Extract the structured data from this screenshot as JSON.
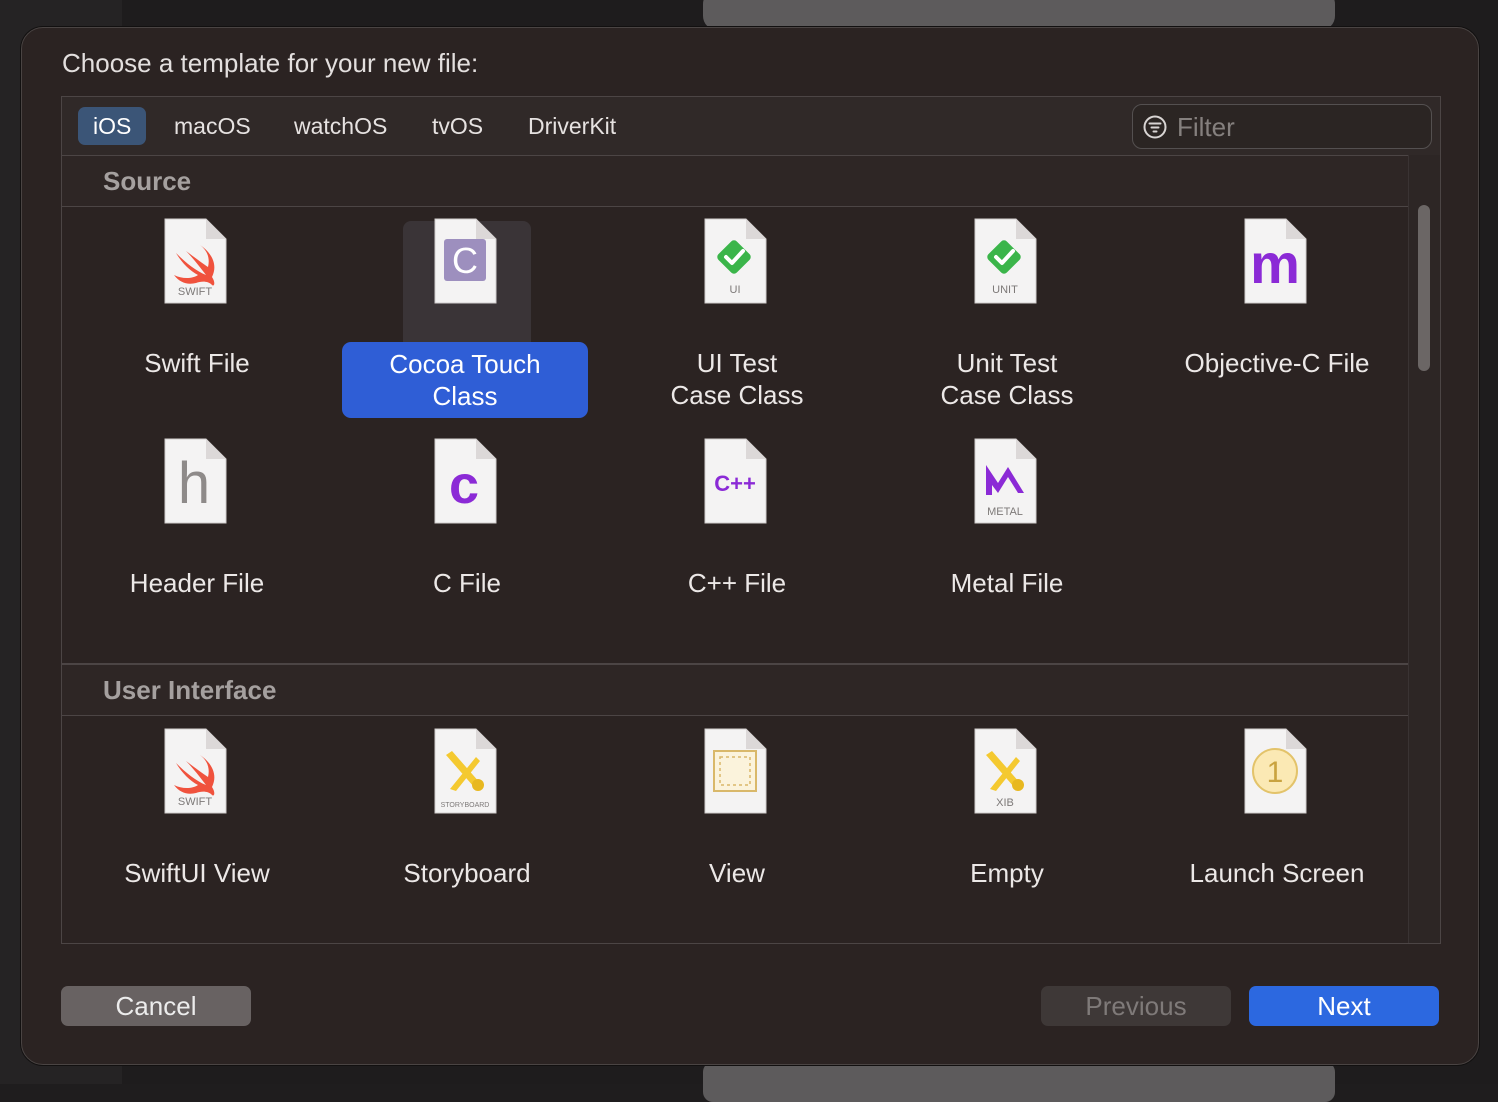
{
  "dialog": {
    "title": "Choose a template for your new file:",
    "tabs": [
      {
        "label": "iOS",
        "selected": true
      },
      {
        "label": "macOS",
        "selected": false
      },
      {
        "label": "watchOS",
        "selected": false
      },
      {
        "label": "tvOS",
        "selected": false
      },
      {
        "label": "DriverKit",
        "selected": false
      }
    ],
    "filter": {
      "placeholder": "Filter",
      "icon": "filter-icon"
    },
    "sections": [
      {
        "title": "Source",
        "items": [
          {
            "label": "Swift File",
            "icon": "swift-file-icon",
            "badge": "SWIFT"
          },
          {
            "label_lines": [
              "Cocoa Touch",
              "Class"
            ],
            "icon": "cocoa-touch-class-icon",
            "selected": true
          },
          {
            "label_lines": [
              "UI Test",
              "Case Class"
            ],
            "icon": "ui-test-icon",
            "badge": "UI"
          },
          {
            "label_lines": [
              "Unit Test",
              "Case Class"
            ],
            "icon": "unit-test-icon",
            "badge": "UNIT"
          },
          {
            "label": "Objective-C File",
            "icon": "objective-c-file-icon"
          },
          {
            "label": "Header File",
            "icon": "header-file-icon"
          },
          {
            "label": "C File",
            "icon": "c-file-icon"
          },
          {
            "label": "C++ File",
            "icon": "cpp-file-icon",
            "glyph": "C++"
          },
          {
            "label": "Metal File",
            "icon": "metal-file-icon",
            "badge": "METAL"
          }
        ]
      },
      {
        "title": "User Interface",
        "items": [
          {
            "label": "SwiftUI View",
            "icon": "swiftui-view-icon",
            "badge": "SWIFT"
          },
          {
            "label": "Storyboard",
            "icon": "storyboard-icon",
            "badge": "STORYBOARD"
          },
          {
            "label": "View",
            "icon": "view-icon"
          },
          {
            "label": "Empty",
            "icon": "xib-empty-icon",
            "badge": "XIB"
          },
          {
            "label": "Launch Screen",
            "icon": "launch-screen-icon",
            "glyph": "1"
          }
        ]
      }
    ],
    "buttons": {
      "cancel": "Cancel",
      "previous": "Previous",
      "next": "Next"
    },
    "colors": {
      "accent": "#2c68e0",
      "selection": "#2f5ed6",
      "tab_selected": "#3b5577"
    }
  }
}
